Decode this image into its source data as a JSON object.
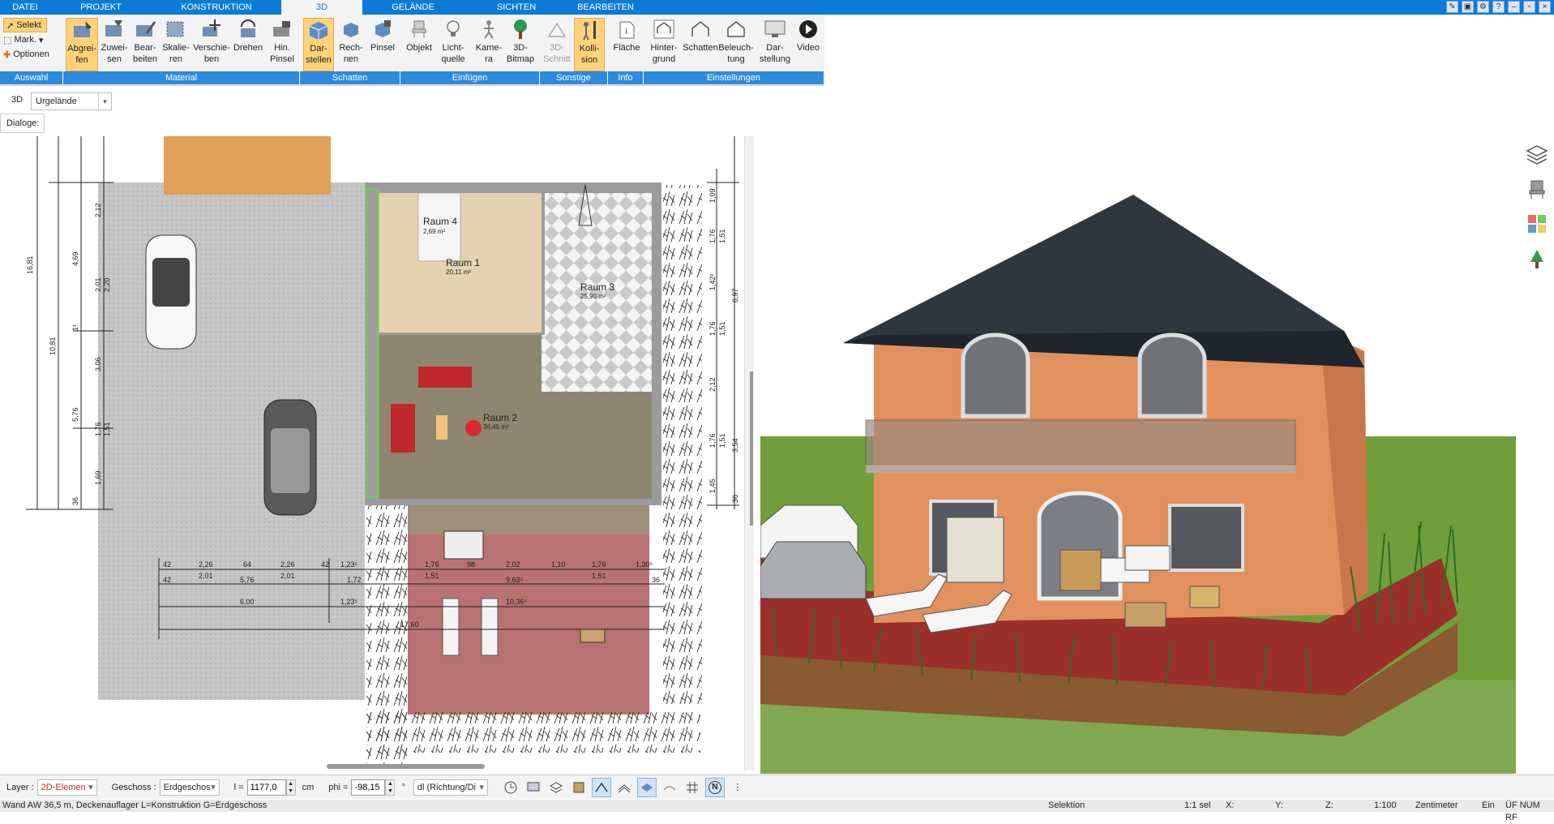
{
  "menubar": {
    "tabs": [
      {
        "label": "DATEI",
        "active": false
      },
      {
        "label": "PROJEKT",
        "active": false
      },
      {
        "label": "KONSTRUKTION",
        "active": false
      },
      {
        "label": "3D",
        "active": true
      },
      {
        "label": "GELÄNDE",
        "active": false
      },
      {
        "label": "SICHTEN",
        "active": false
      },
      {
        "label": "BEARBEITEN",
        "active": false
      }
    ]
  },
  "ribbon": {
    "selection": {
      "selekt": "Selekt",
      "mark": "Mark.",
      "optionen": "Optionen"
    },
    "buttons": {
      "abgreifen": "Abgrei-\nfen",
      "zuweisen": "Zuwei-\nsen",
      "bearbeiten": "Bear-\nbeiten",
      "skalieren": "Skalie-\nren",
      "verschieben": "Verschie-\nben",
      "drehen": "Drehen",
      "hinpinsel": "Hin.\nPinsel",
      "darstellen": "Dar-\nstellen",
      "rechnen": "Rech-\nnen",
      "pinsel": "Pinsel",
      "objekt": "Objekt",
      "lichtquelle": "Licht-\nquelle",
      "kamera": "Kame-\nra",
      "bitmap3d": "3D-\nBitmap",
      "schnitt3d": "3D-\nSchnitt",
      "kollision": "Kolli-\nsion",
      "flaeche": "Fläche",
      "hintergrund": "Hinter-\ngrund",
      "schatten": "Schatten",
      "beleuchtung": "Beleuch-\ntung",
      "darstellung": "Dar-\nstellung",
      "video": "Video"
    },
    "groups": {
      "auswahl": "Auswahl",
      "material": "Material",
      "schatten": "Schatten",
      "einfuegen": "Einfügen",
      "sonstige": "Sonstige",
      "info": "Info",
      "einstellungen": "Einstellungen"
    }
  },
  "viewbar": {
    "mode": "3D",
    "terrain": "Urgelände",
    "dialoge": "Dialoge:"
  },
  "plan": {
    "rooms": [
      {
        "name": "Raum 4",
        "area": "2,69 m²"
      },
      {
        "name": "Raum 1",
        "area": "20,11 m²"
      },
      {
        "name": "Raum 3",
        "area": "25,90 m²"
      },
      {
        "name": "Raum 2",
        "area": "36,45 m²"
      }
    ],
    "dims_left": [
      "16,81",
      "10,81",
      "4,69",
      "2,12",
      "2,01",
      "2,20",
      "1¹",
      "3,06",
      "5,76",
      "1,76",
      "1,51",
      "1,69",
      "36"
    ],
    "dims_right": [
      "1,09",
      "1,76",
      "1,51",
      "1,42²",
      "6,97",
      "1,76",
      "1,51",
      "2,12",
      "1,76",
      "1,51",
      "3,54",
      "1,45",
      "36"
    ],
    "dims_bottom_row1": [
      "42",
      "2,26",
      "64",
      "2,26",
      "42",
      "1,23⁵",
      "1,76",
      "98",
      "2,02",
      "1,10",
      "1,76",
      "1,30⁵"
    ],
    "dims_bottom_row1b": [
      "2,01",
      "2,01",
      "1,51",
      "1,51"
    ],
    "dims_bottom_row2": [
      "42",
      "5,76",
      "1,72",
      "9,63⁵",
      "36"
    ],
    "dims_bottom_row3": [
      "6,00",
      "1,23⁵",
      "10,36⁵"
    ],
    "dims_bottom_row4": [
      "17,60"
    ]
  },
  "bottombar": {
    "layer_label": "Layer :",
    "layer_value": "2D-Elemen",
    "geschoss_label": "Geschoss :",
    "geschoss_value": "Erdgeschos",
    "l_label": "l =",
    "l_value": "1177,0",
    "l_unit": "cm",
    "phi_label": "phi =",
    "phi_value": "-98,15",
    "phi_unit": "°",
    "dl_value": "dl (Richtung/Di",
    "north": "N"
  },
  "statusbar": {
    "message": "Wand AW 36,5 m, Deckenauflager L=Konstruktion G=Erdgeschoss",
    "mode": "Selektion",
    "sel": "1:1 sel",
    "x": "X:",
    "y": "Y:",
    "z": "Z:",
    "scale": "1:100",
    "unit": "Zentimeter",
    "ein": "Ein",
    "flags": "ÜF NUM RF"
  },
  "colors": {
    "menubar": "#0a7bd7",
    "groupbar": "#2f89dc",
    "active_button": "#ffd27a",
    "wall_facade": "#e0915d",
    "roof": "#2f3640",
    "lawn": "#6f9e3b",
    "terrace": "#9b2f2a"
  }
}
